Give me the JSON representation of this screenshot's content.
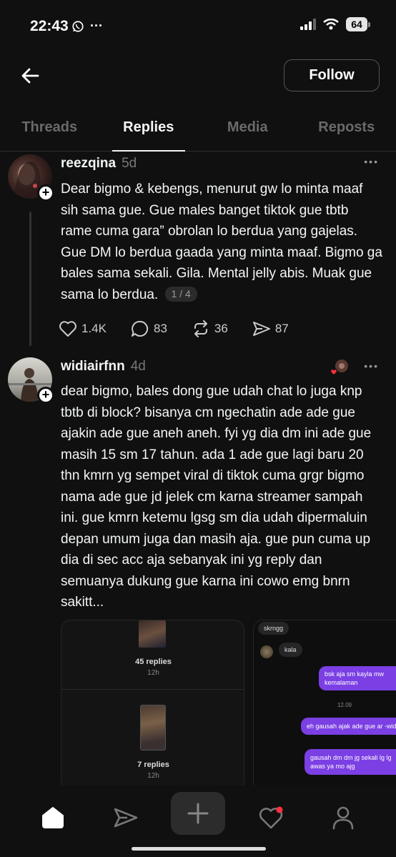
{
  "status": {
    "time": "22:43",
    "battery": "64",
    "more": "···"
  },
  "header": {
    "follow_label": "Follow"
  },
  "tabs": [
    {
      "label": "Threads",
      "active": false
    },
    {
      "label": "Replies",
      "active": true
    },
    {
      "label": "Media",
      "active": false
    },
    {
      "label": "Reposts",
      "active": false
    }
  ],
  "posts": [
    {
      "username": "reezqina",
      "time": "5d",
      "more": "•••",
      "text": "Dear bigmo & kebengs, menurut gw lo minta maaf sih sama gue. Gue males banget tiktok gue tbtb rame cuma gara” obrolan lo berdua yang gajelas. Gue DM lo berdua gaada yang minta maaf. Bigmo ga bales sama sekali. Gila. Mental jelly abis. Muak gue sama lo berdua.",
      "page_badge": "1 / 4",
      "likes": "1.4K",
      "comments": "83",
      "reposts": "36",
      "shares": "87"
    },
    {
      "username": "widiairfnn",
      "time": "4d",
      "more": "•••",
      "text": "dear bigmo, bales dong gue udah chat lo juga knp tbtb di block? bisanya cm ngechatin ade ade gue ajakin ade gue aneh aneh. fyi yg dia dm ini ade gue masih 15 sm 17 tahun. ada 1 ade gue lagi baru 20 thn kmrn yg sempet viral di tiktok cuma grgr bigmo nama ade gue jd jelek cm karna streamer sampah ini. gue kmrn ketemu lgsg sm dia udah dipermaluin depan umum juga dan masih aja. gue pun cuma up dia di sec acc aja sebanyak ini yg reply dan semuanya dukung gue karna ini cowo emg bnrn sakitt..."
    }
  ],
  "media": {
    "card1": {
      "item1_replies": "45 replies",
      "item1_time": "12h",
      "item2_replies": "7 replies",
      "item2_time": "12h"
    },
    "card2": {
      "msg1": "skrngg",
      "msg2": "kala",
      "msg3": "bsk aja sm kayla mw kemalaman",
      "timestamp": "12.09",
      "msg4": "eh gausah ajak ade gue ar -widia",
      "msg5": "gausah dm dm jg sekali lg lg awas ya mo ajg"
    }
  },
  "nav": {
    "items": [
      "home-icon",
      "send-icon",
      "create-icon",
      "activity-icon",
      "profile-icon"
    ]
  },
  "colors": {
    "background": "#101010",
    "accent_purple": "#7b3fe4",
    "notification_red": "#ff3040"
  }
}
